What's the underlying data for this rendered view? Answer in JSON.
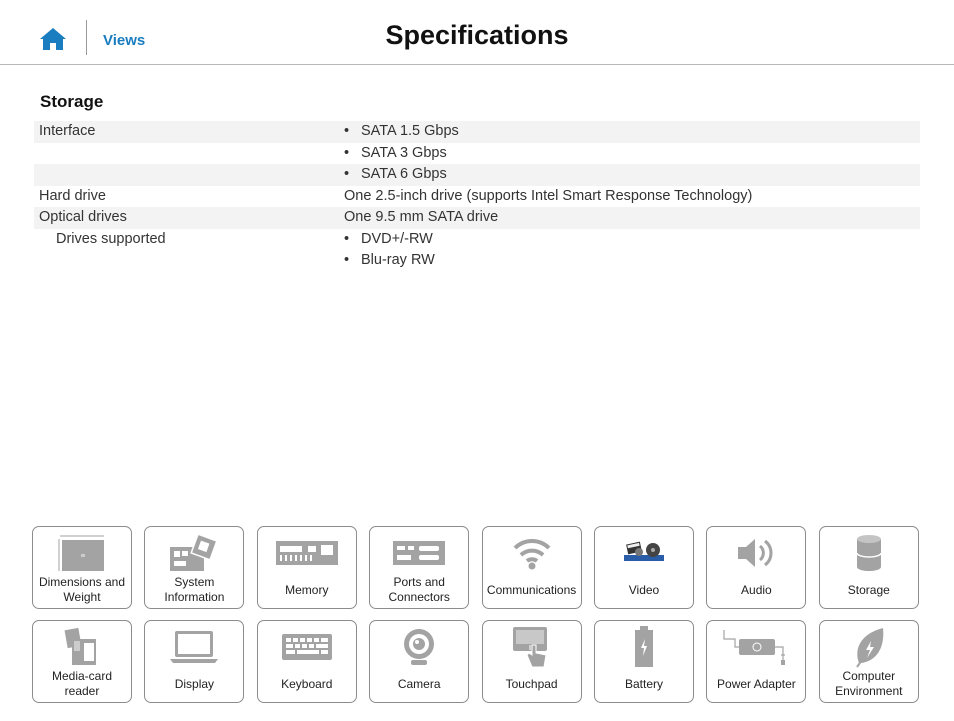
{
  "header": {
    "home_icon": "home-icon",
    "views_label": "Views",
    "title": "Specifications"
  },
  "section_title": "Storage",
  "spec_rows": [
    {
      "label": "Interface",
      "value": "SATA 1.5 Gbps",
      "bullet": true,
      "shade": true
    },
    {
      "label": "",
      "value": "SATA 3 Gbps",
      "bullet": true,
      "shade": false
    },
    {
      "label": "",
      "value": "SATA 6 Gbps",
      "bullet": true,
      "shade": true
    },
    {
      "label": "Hard drive",
      "value": "One 2.5-inch drive (supports Intel Smart Response Technology)",
      "bullet": false,
      "shade": false
    },
    {
      "label": "Optical drives",
      "value": "One 9.5 mm SATA drive",
      "bullet": false,
      "shade": true
    },
    {
      "label": "Drives supported",
      "value": "DVD+/-RW",
      "bullet": true,
      "shade": false,
      "indent": true
    },
    {
      "label": "",
      "value": "Blu-ray RW",
      "bullet": true,
      "shade": false
    }
  ],
  "tiles": [
    {
      "label": "Dimensions and Weight",
      "icon": "dimensions-icon"
    },
    {
      "label": "System Information",
      "icon": "system-board-icon"
    },
    {
      "label": "Memory",
      "icon": "memory-icon"
    },
    {
      "label": "Ports and Connectors",
      "icon": "ports-icon"
    },
    {
      "label": "Communications",
      "icon": "wifi-icon"
    },
    {
      "label": "Video",
      "icon": "video-icon"
    },
    {
      "label": "Audio",
      "icon": "speaker-icon"
    },
    {
      "label": "Storage",
      "icon": "storage-icon"
    },
    {
      "label": "Media-card reader",
      "icon": "media-card-icon"
    },
    {
      "label": "Display",
      "icon": "display-icon"
    },
    {
      "label": "Keyboard",
      "icon": "keyboard-icon"
    },
    {
      "label": "Camera",
      "icon": "camera-icon"
    },
    {
      "label": "Touchpad",
      "icon": "touchpad-icon"
    },
    {
      "label": "Battery",
      "icon": "battery-icon"
    },
    {
      "label": "Power Adapter",
      "icon": "power-adapter-icon"
    },
    {
      "label": "Computer Environment",
      "icon": "leaf-icon"
    }
  ],
  "colors": {
    "accent": "#1a7dc0",
    "icon_gray": "#a3a3a3",
    "row_shade": "#f3f3f3",
    "tile_border": "#8c8c8c"
  }
}
